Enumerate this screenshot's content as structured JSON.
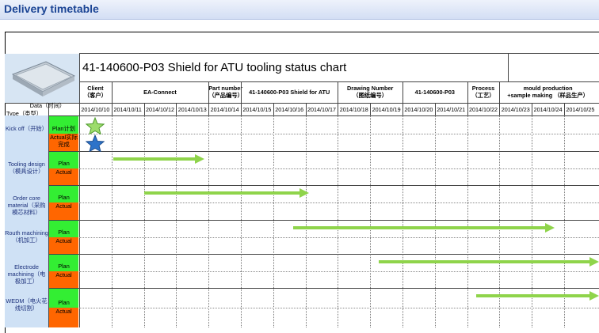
{
  "page": {
    "title": "Delivery timetable"
  },
  "chart": {
    "title": "41-140600-P03 Shield for ATU  tooling status chart",
    "header_cells": [
      {
        "text": "Client\n（客户）"
      },
      {
        "text": "EA-Connect"
      },
      {
        "text": "Part number\n（产品编号）"
      },
      {
        "text": "41-140600-P03 Shield for ATU"
      },
      {
        "text": "Drawing Number\n（图纸编号）"
      },
      {
        "text": "41-140600-P03"
      },
      {
        "text": "Process\n（工艺）"
      },
      {
        "text": "mould production\n+sample making （样品生产）"
      }
    ],
    "corner": {
      "data": "Data（时间）",
      "type": "Type（类型）"
    },
    "dates": [
      "2014/10/10",
      "2014/10/11",
      "2014/10/12",
      "2014/10/13",
      "2014/10/14",
      "2014/10/15",
      "2014/10/16",
      "2014/10/17",
      "2014/10/18",
      "2014/10/19",
      "2014/10/20",
      "2014/10/21",
      "2014/10/22",
      "2014/10/23",
      "2014/10/24",
      "2014/10/25"
    ],
    "rows": [
      {
        "type": "Kick off（开始）",
        "plan": "Plan计划",
        "actual": "Actual实际完成"
      },
      {
        "type": "Tooling design（模具设计）",
        "plan": "Plan",
        "actual": "Actual"
      },
      {
        "type": "Order core material（采购模芯材料）",
        "plan": "Plan",
        "actual": "Actual"
      },
      {
        "type": "Routh machining（机加工）",
        "plan": "Plan",
        "actual": "Actual"
      },
      {
        "type": "Electrode machining（电极加工）",
        "plan": "Plan",
        "actual": "Actual"
      },
      {
        "type": "WEDM（电火花线切割）",
        "plan": "Plan",
        "actual": "Actual"
      }
    ],
    "icons": {
      "plan_marker": "green-star-icon",
      "actual_marker": "blue-star-icon",
      "arrow": "green-arrow-icon"
    },
    "colors": {
      "plan": "#33ee33",
      "actual": "#ff6600",
      "arrow": "#8fd44b",
      "type_bg": "#cfe1f5"
    }
  }
}
